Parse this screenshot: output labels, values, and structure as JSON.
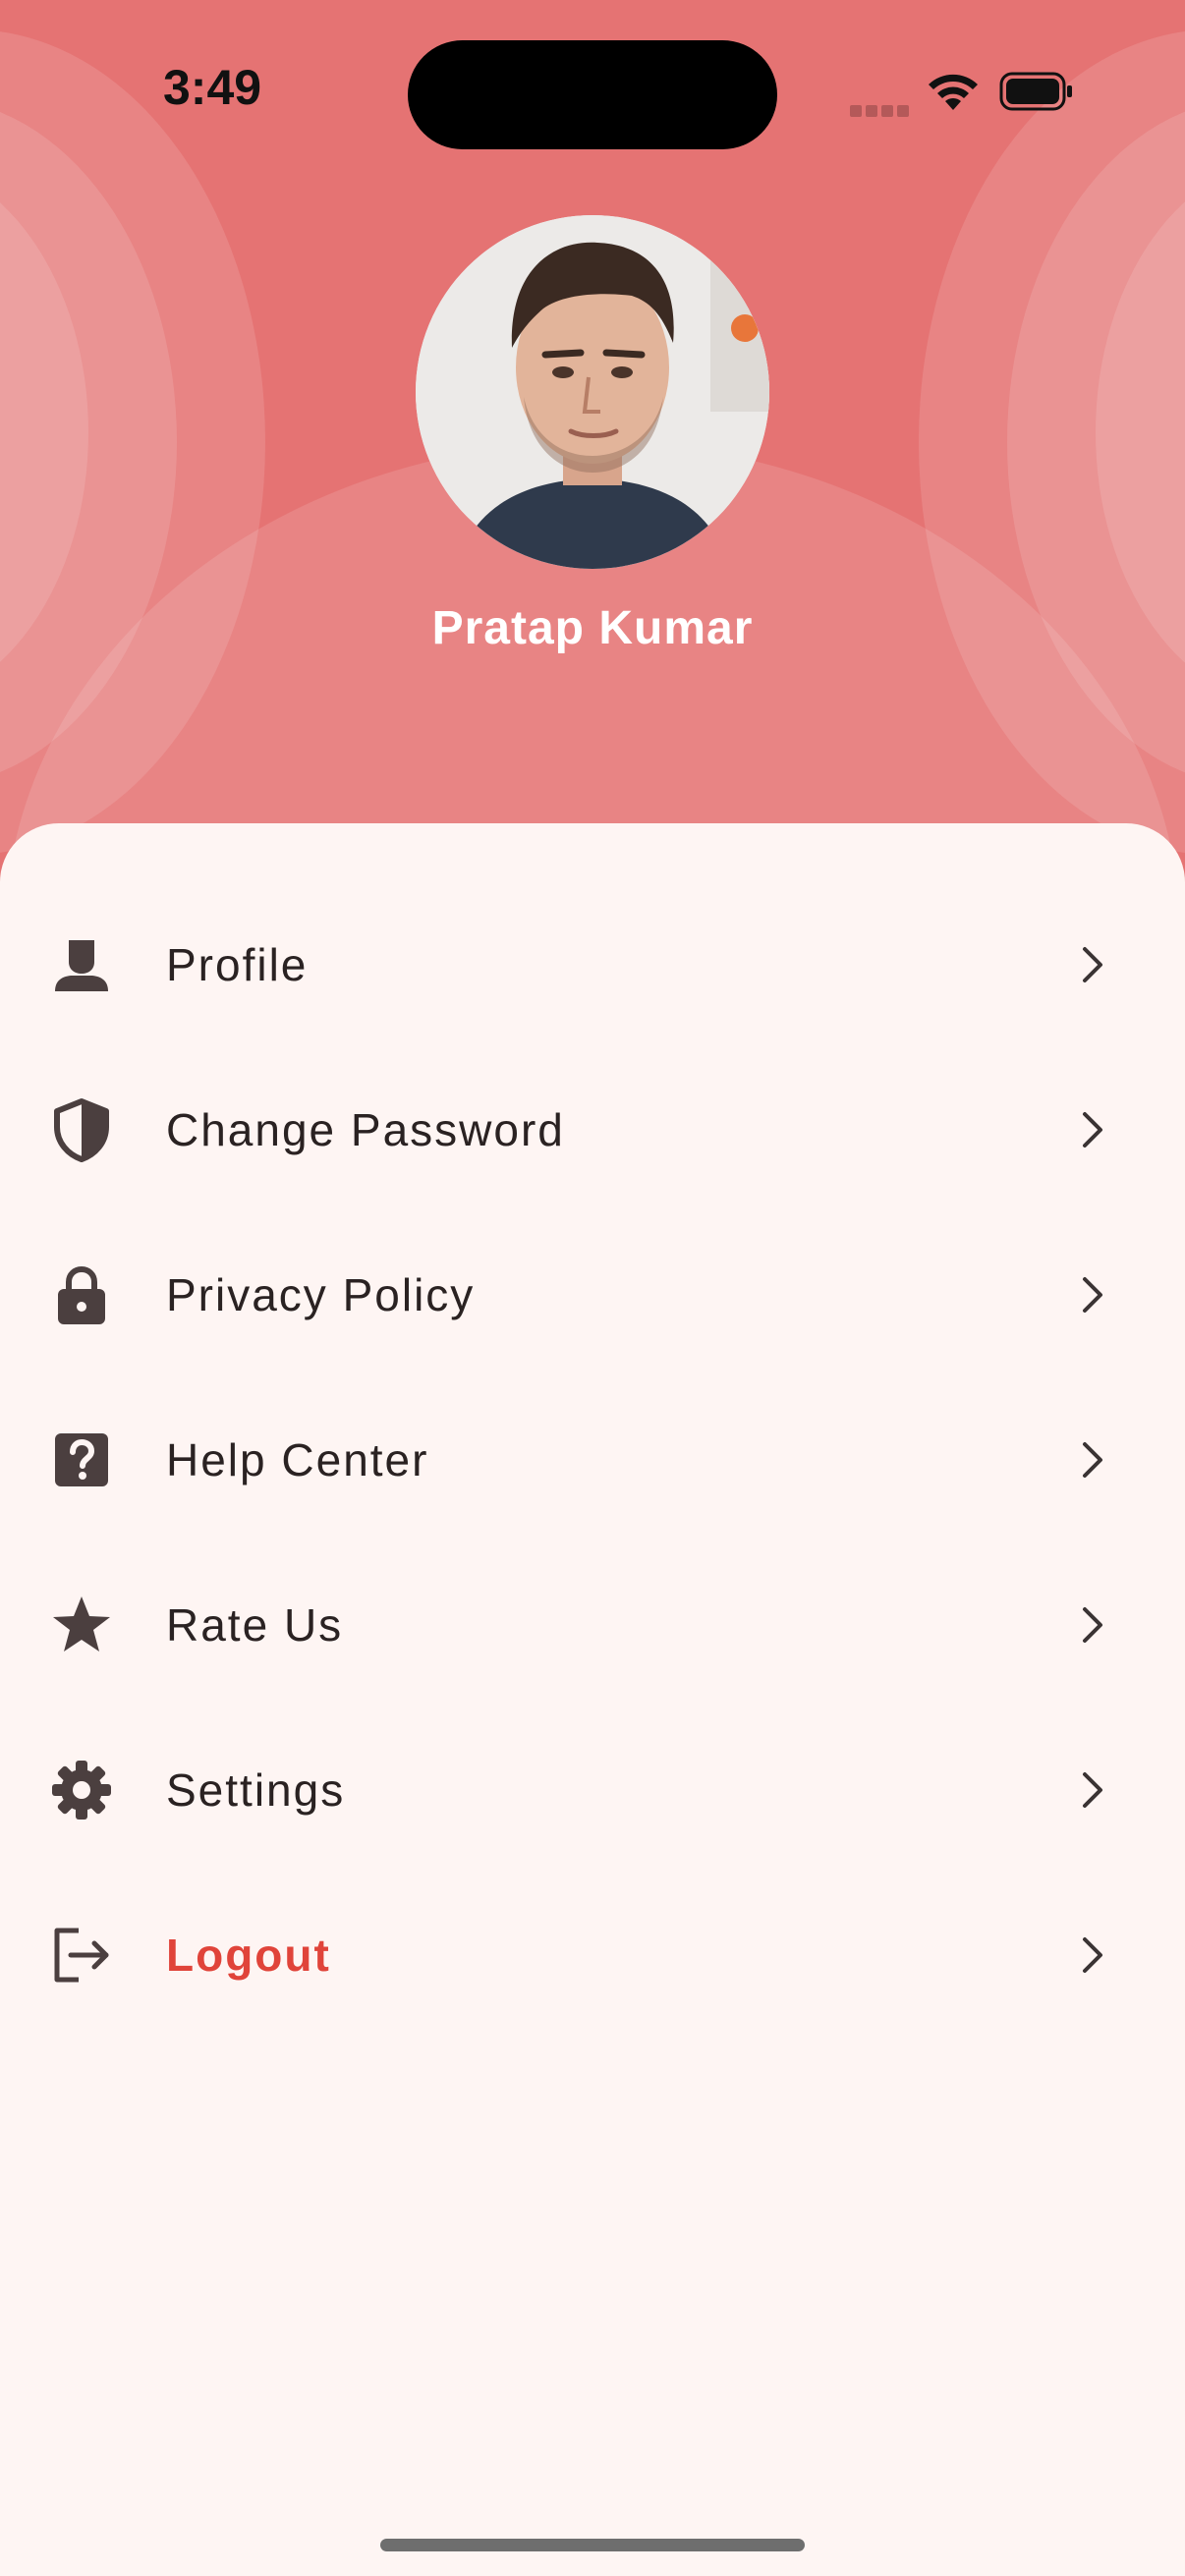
{
  "status_bar": {
    "time": "3:49"
  },
  "profile": {
    "name": "Pratap Kumar"
  },
  "menu": [
    {
      "label": "Profile",
      "icon": "person-icon"
    },
    {
      "label": "Change Password",
      "icon": "shield-icon"
    },
    {
      "label": "Privacy Policy",
      "icon": "lock-icon"
    },
    {
      "label": "Help Center",
      "icon": "help-icon"
    },
    {
      "label": "Rate Us",
      "icon": "star-icon"
    },
    {
      "label": "Settings",
      "icon": "gear-icon"
    },
    {
      "label": "Logout",
      "icon": "logout-icon"
    }
  ],
  "colors": {
    "header": "#e57373",
    "sheet": "#fef5f3",
    "logout": "#e0443a",
    "icon": "#4b3f3f"
  }
}
